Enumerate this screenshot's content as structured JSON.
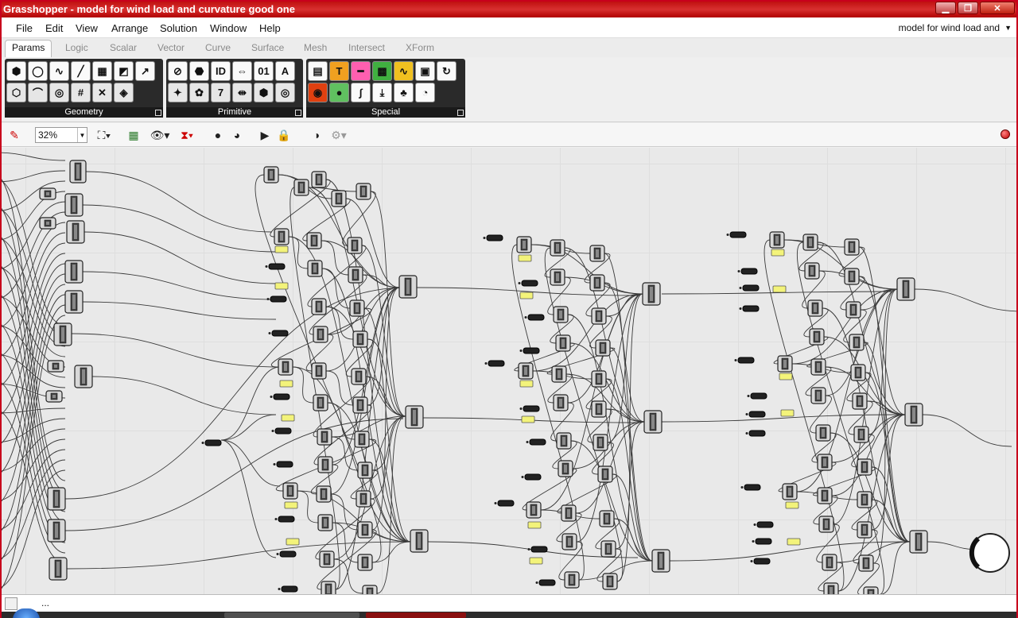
{
  "window": {
    "title": "Grasshopper - model for wind load and curvature good one",
    "min_label": "▁",
    "max_label": "❐",
    "close_label": "✕"
  },
  "menu": {
    "items": [
      "File",
      "Edit",
      "View",
      "Arrange",
      "Solution",
      "Window",
      "Help"
    ],
    "document_selector": "model for wind load and"
  },
  "tabs": [
    "Params",
    "Logic",
    "Scalar",
    "Vector",
    "Curve",
    "Surface",
    "Mesh",
    "Intersect",
    "XForm"
  ],
  "active_tab": "Params",
  "ribbon": {
    "panels": [
      {
        "label": "Geometry",
        "icons": [
          "box-param-icon",
          "circle-param-icon",
          "curve-param-icon",
          "line-param-icon",
          "plane-param-icon",
          "surface-param-icon",
          "vector-param-icon",
          "brep-param-icon",
          "arc-param-icon",
          "spiral-param-icon",
          "mesh-param-icon",
          "cancel-param-icon",
          "geometry-param-icon"
        ]
      },
      {
        "label": "Primitive",
        "icons": [
          "boolean-param-icon",
          "colour-param-icon",
          "id-param-icon",
          "domain-param-icon",
          "integer-param-icon",
          "string-param-icon",
          "fill-param-icon",
          "shader-param-icon",
          "number-param-icon",
          "interval-param-icon",
          "matrix-param-icon",
          "time-param-icon"
        ]
      },
      {
        "label": "Special",
        "icons": [
          "panel-param-icon",
          "colour-swatch-icon",
          "slider-icon",
          "graph-mapper-icon",
          "scribble-icon",
          "image-sampler-icon",
          "loop-icon",
          "gradient-icon",
          "sphere-icon",
          "curve-graph-icon",
          "param-viewer-icon",
          "tree-icon",
          "gauge-icon"
        ]
      }
    ]
  },
  "canvas_toolbar": {
    "zoom": "32%"
  },
  "status": {
    "text": "..."
  }
}
